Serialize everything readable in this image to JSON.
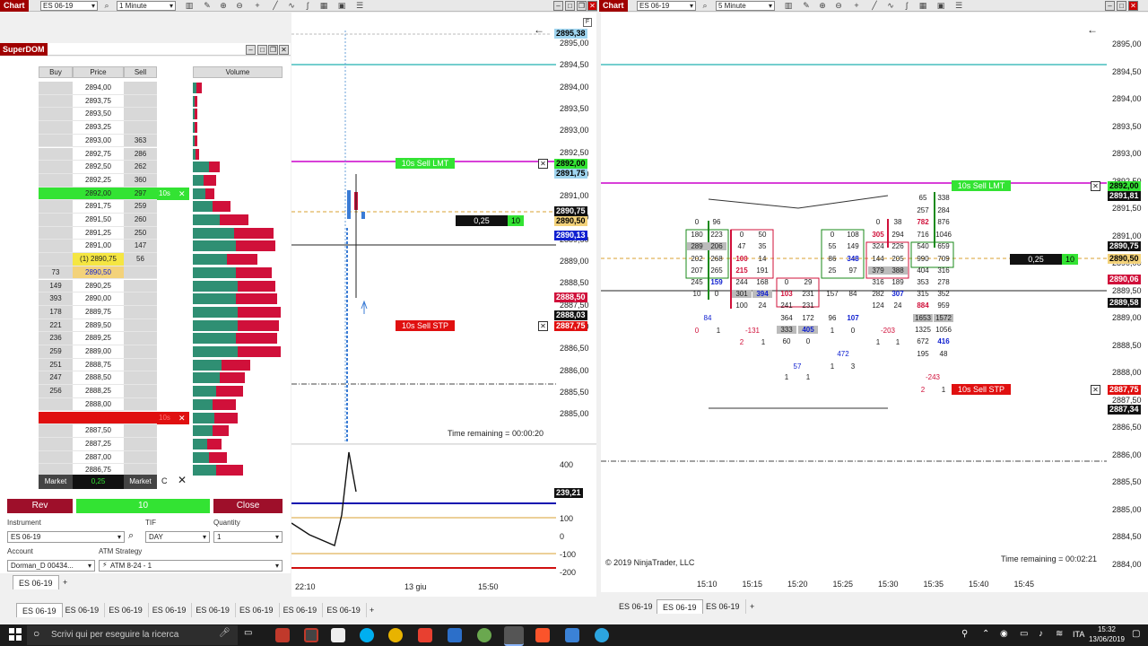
{
  "left_window": {
    "title": "Chart",
    "instrument": "ES 06-19",
    "interval": "1 Minute"
  },
  "right_window": {
    "title": "Chart",
    "instrument": "ES 06-19",
    "interval": "5 Minute"
  },
  "superdom": {
    "title": "SuperDOM",
    "headers": {
      "buy": "Buy",
      "price": "Price",
      "sell": "Sell",
      "volume": "Volume"
    },
    "rows": [
      {
        "buy": "",
        "price": "2894,00",
        "sell": "",
        "vg": 4,
        "vr": 6
      },
      {
        "buy": "",
        "price": "2893,75",
        "sell": "",
        "vg": 2,
        "vr": 3
      },
      {
        "buy": "",
        "price": "2893,50",
        "sell": "",
        "vg": 2,
        "vr": 3
      },
      {
        "buy": "",
        "price": "2893,25",
        "sell": "",
        "vg": 2,
        "vr": 3
      },
      {
        "buy": "",
        "price": "2893,00",
        "sell": "363",
        "vg": 2,
        "vr": 3
      },
      {
        "buy": "",
        "price": "2892,75",
        "sell": "286",
        "vg": 3,
        "vr": 4
      },
      {
        "buy": "",
        "price": "2892,50",
        "sell": "262",
        "vg": 18,
        "vr": 12
      },
      {
        "buy": "",
        "price": "2892,25",
        "sell": "360",
        "vg": 12,
        "vr": 14
      },
      {
        "buy": "",
        "price": "2892,00",
        "sell": "297",
        "vg": 14,
        "vr": 10,
        "highlight": "lmt",
        "order_label": "10s"
      },
      {
        "buy": "",
        "price": "2891,75",
        "sell": "259",
        "vg": 22,
        "vr": 20
      },
      {
        "buy": "",
        "price": "2891,50",
        "sell": "260",
        "vg": 30,
        "vr": 32
      },
      {
        "buy": "",
        "price": "2891,25",
        "sell": "250",
        "vg": 46,
        "vr": 44
      },
      {
        "buy": "",
        "price": "2891,00",
        "sell": "147",
        "vg": 48,
        "vr": 44
      },
      {
        "buy": "",
        "price": "(1) 2890,75",
        "sell": "56",
        "vg": 38,
        "vr": 34,
        "highlight": "last"
      },
      {
        "buy": "73",
        "price": "2890,50",
        "sell": "",
        "vg": 48,
        "vr": 40,
        "highlight": "bid"
      },
      {
        "buy": "149",
        "price": "2890,25",
        "sell": "",
        "vg": 50,
        "vr": 42
      },
      {
        "buy": "393",
        "price": "2890,00",
        "sell": "",
        "vg": 48,
        "vr": 46
      },
      {
        "buy": "178",
        "price": "2889,75",
        "sell": "",
        "vg": 50,
        "vr": 48
      },
      {
        "buy": "221",
        "price": "2889,50",
        "sell": "",
        "vg": 50,
        "vr": 46
      },
      {
        "buy": "236",
        "price": "2889,25",
        "sell": "",
        "vg": 48,
        "vr": 46
      },
      {
        "buy": "259",
        "price": "2889,00",
        "sell": "",
        "vg": 50,
        "vr": 48
      },
      {
        "buy": "251",
        "price": "2888,75",
        "sell": "",
        "vg": 32,
        "vr": 32
      },
      {
        "buy": "247",
        "price": "2888,50",
        "sell": "",
        "vg": 30,
        "vr": 28
      },
      {
        "buy": "256",
        "price": "2888,25",
        "sell": "",
        "vg": 26,
        "vr": 30
      },
      {
        "buy": "",
        "price": "2888,00",
        "sell": "",
        "vg": 22,
        "vr": 26
      },
      {
        "buy": "",
        "price": "2887,75",
        "sell": "",
        "vg": 24,
        "vr": 26,
        "highlight": "stp",
        "order_label": "10s"
      },
      {
        "buy": "",
        "price": "2887,50",
        "sell": "",
        "vg": 22,
        "vr": 18
      },
      {
        "buy": "",
        "price": "2887,25",
        "sell": "",
        "vg": 16,
        "vr": 16
      },
      {
        "buy": "",
        "price": "2887,00",
        "sell": "",
        "vg": 18,
        "vr": 20
      },
      {
        "buy": "",
        "price": "2886,75",
        "sell": "",
        "vg": 26,
        "vr": 30
      }
    ],
    "footer": {
      "market_left": "Market",
      "pnl": "0,25",
      "market_right": "Market",
      "c_label": "C"
    },
    "rev_label": "Rev",
    "qty_value": "10",
    "close_label": "Close",
    "instrument_label": "Instrument",
    "instrument_value": "ES 06-19",
    "tif_label": "TIF",
    "tif_value": "DAY",
    "quantity_label": "Quantity",
    "quantity_value": "1",
    "account_label": "Account",
    "account_value": "Dorman_D 00434...",
    "atm_label": "ATM Strategy",
    "atm_value": "ATM 8-24 - 1",
    "tab": "ES 06-19",
    "add_tab": "+"
  },
  "left_chart": {
    "y_labels": [
      "2895,00",
      "2894,50",
      "2894,00",
      "2893,50",
      "2893,00",
      "2892,50",
      "2891,50",
      "2891,00",
      "2890,00",
      "2889,50",
      "2889,00",
      "2888,50",
      "2887,50",
      "2887,00",
      "2886,50",
      "2886,00",
      "2885,50",
      "2885,00"
    ],
    "price_tags": {
      "top": "2895,38",
      "lmt_price": "2892,00",
      "ask": "2891,75",
      "last": "2890,75",
      "avg": "2890,50",
      "bid": "2890,13",
      "red1": "2888,50",
      "black2": "2888,03",
      "stp": "2887,75"
    },
    "sell_lmt_label": "10s Sell LMT",
    "sell_stp_label": "10s Sell STP",
    "position_pnl": "0,25",
    "position_qty": "10",
    "time_remaining": "Time remaining = 00:00:20",
    "osc_labels": [
      "400",
      "200",
      "100",
      "0",
      "-100",
      "-200"
    ],
    "osc_tag": "239,21",
    "x_labels": [
      "22:10",
      "13 giu",
      "15:50"
    ]
  },
  "right_chart": {
    "y_labels": [
      "2895,00",
      "2894,50",
      "2894,00",
      "2893,50",
      "2893,00",
      "2892,50",
      "2891,50",
      "2891,00",
      "2890,00",
      "2889,50",
      "2889,00",
      "2888,50",
      "2888,00",
      "2887,50",
      "2886,50",
      "2886,00",
      "2885,50",
      "2885,00",
      "2884,50",
      "2884,00"
    ],
    "price_tags": {
      "lmt_price": "2892,00",
      "ask": "2891,81",
      "last": "2890,75",
      "avg": "2890,50",
      "red": "2890,06",
      "black": "2889,58",
      "stp": "2887,75",
      "black2": "2887,34"
    },
    "sell_lmt_label": "10s Sell LMT",
    "sell_stp_label": "10s Sell STP",
    "position_pnl": "0,25",
    "position_qty": "10",
    "copyright": "© 2019 NinjaTrader, LLC",
    "time_remaining": "Time remaining = 00:02:21",
    "x_labels": [
      "15:10",
      "15:15",
      "15:20",
      "15:25",
      "15:30",
      "15:35",
      "15:40",
      "15:45"
    ],
    "tabs": [
      "ES 06-19",
      "ES 06-19",
      "ES 06-19"
    ],
    "add_tab": "+"
  },
  "bottom_tabs": [
    "ES 06-19",
    "ES 06-19",
    "ES 06-19",
    "ES 06-19",
    "ES 06-19",
    "ES 06-19",
    "ES 06-19",
    "ES 06-19"
  ],
  "bottom_add": "+",
  "taskbar": {
    "search_placeholder": "Scrivi qui per eseguire la ricerca",
    "lang": "ITA",
    "time": "15:32",
    "date": "13/06/2019"
  },
  "colors": {
    "green": "#2f8f73",
    "red": "#d0103a",
    "lime": "#33e333",
    "stop_red": "#e01010",
    "magenta": "#cc00cc",
    "cyan": "#20b0b0"
  }
}
